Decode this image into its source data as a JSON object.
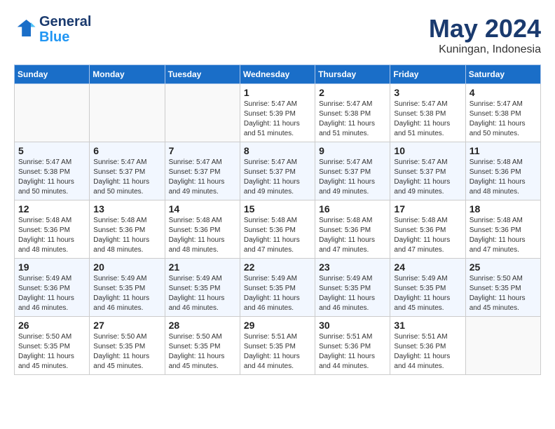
{
  "header": {
    "logo_line1": "General",
    "logo_line2": "Blue",
    "month": "May 2024",
    "location": "Kuningan, Indonesia"
  },
  "days_of_week": [
    "Sunday",
    "Monday",
    "Tuesday",
    "Wednesday",
    "Thursday",
    "Friday",
    "Saturday"
  ],
  "weeks": [
    [
      {
        "day": "",
        "info": ""
      },
      {
        "day": "",
        "info": ""
      },
      {
        "day": "",
        "info": ""
      },
      {
        "day": "1",
        "info": "Sunrise: 5:47 AM\nSunset: 5:39 PM\nDaylight: 11 hours and 51 minutes."
      },
      {
        "day": "2",
        "info": "Sunrise: 5:47 AM\nSunset: 5:38 PM\nDaylight: 11 hours and 51 minutes."
      },
      {
        "day": "3",
        "info": "Sunrise: 5:47 AM\nSunset: 5:38 PM\nDaylight: 11 hours and 51 minutes."
      },
      {
        "day": "4",
        "info": "Sunrise: 5:47 AM\nSunset: 5:38 PM\nDaylight: 11 hours and 50 minutes."
      }
    ],
    [
      {
        "day": "5",
        "info": "Sunrise: 5:47 AM\nSunset: 5:38 PM\nDaylight: 11 hours and 50 minutes."
      },
      {
        "day": "6",
        "info": "Sunrise: 5:47 AM\nSunset: 5:37 PM\nDaylight: 11 hours and 50 minutes."
      },
      {
        "day": "7",
        "info": "Sunrise: 5:47 AM\nSunset: 5:37 PM\nDaylight: 11 hours and 49 minutes."
      },
      {
        "day": "8",
        "info": "Sunrise: 5:47 AM\nSunset: 5:37 PM\nDaylight: 11 hours and 49 minutes."
      },
      {
        "day": "9",
        "info": "Sunrise: 5:47 AM\nSunset: 5:37 PM\nDaylight: 11 hours and 49 minutes."
      },
      {
        "day": "10",
        "info": "Sunrise: 5:47 AM\nSunset: 5:37 PM\nDaylight: 11 hours and 49 minutes."
      },
      {
        "day": "11",
        "info": "Sunrise: 5:48 AM\nSunset: 5:36 PM\nDaylight: 11 hours and 48 minutes."
      }
    ],
    [
      {
        "day": "12",
        "info": "Sunrise: 5:48 AM\nSunset: 5:36 PM\nDaylight: 11 hours and 48 minutes."
      },
      {
        "day": "13",
        "info": "Sunrise: 5:48 AM\nSunset: 5:36 PM\nDaylight: 11 hours and 48 minutes."
      },
      {
        "day": "14",
        "info": "Sunrise: 5:48 AM\nSunset: 5:36 PM\nDaylight: 11 hours and 48 minutes."
      },
      {
        "day": "15",
        "info": "Sunrise: 5:48 AM\nSunset: 5:36 PM\nDaylight: 11 hours and 47 minutes."
      },
      {
        "day": "16",
        "info": "Sunrise: 5:48 AM\nSunset: 5:36 PM\nDaylight: 11 hours and 47 minutes."
      },
      {
        "day": "17",
        "info": "Sunrise: 5:48 AM\nSunset: 5:36 PM\nDaylight: 11 hours and 47 minutes."
      },
      {
        "day": "18",
        "info": "Sunrise: 5:48 AM\nSunset: 5:36 PM\nDaylight: 11 hours and 47 minutes."
      }
    ],
    [
      {
        "day": "19",
        "info": "Sunrise: 5:49 AM\nSunset: 5:36 PM\nDaylight: 11 hours and 46 minutes."
      },
      {
        "day": "20",
        "info": "Sunrise: 5:49 AM\nSunset: 5:35 PM\nDaylight: 11 hours and 46 minutes."
      },
      {
        "day": "21",
        "info": "Sunrise: 5:49 AM\nSunset: 5:35 PM\nDaylight: 11 hours and 46 minutes."
      },
      {
        "day": "22",
        "info": "Sunrise: 5:49 AM\nSunset: 5:35 PM\nDaylight: 11 hours and 46 minutes."
      },
      {
        "day": "23",
        "info": "Sunrise: 5:49 AM\nSunset: 5:35 PM\nDaylight: 11 hours and 46 minutes."
      },
      {
        "day": "24",
        "info": "Sunrise: 5:49 AM\nSunset: 5:35 PM\nDaylight: 11 hours and 45 minutes."
      },
      {
        "day": "25",
        "info": "Sunrise: 5:50 AM\nSunset: 5:35 PM\nDaylight: 11 hours and 45 minutes."
      }
    ],
    [
      {
        "day": "26",
        "info": "Sunrise: 5:50 AM\nSunset: 5:35 PM\nDaylight: 11 hours and 45 minutes."
      },
      {
        "day": "27",
        "info": "Sunrise: 5:50 AM\nSunset: 5:35 PM\nDaylight: 11 hours and 45 minutes."
      },
      {
        "day": "28",
        "info": "Sunrise: 5:50 AM\nSunset: 5:35 PM\nDaylight: 11 hours and 45 minutes."
      },
      {
        "day": "29",
        "info": "Sunrise: 5:51 AM\nSunset: 5:35 PM\nDaylight: 11 hours and 44 minutes."
      },
      {
        "day": "30",
        "info": "Sunrise: 5:51 AM\nSunset: 5:36 PM\nDaylight: 11 hours and 44 minutes."
      },
      {
        "day": "31",
        "info": "Sunrise: 5:51 AM\nSunset: 5:36 PM\nDaylight: 11 hours and 44 minutes."
      },
      {
        "day": "",
        "info": ""
      }
    ]
  ]
}
